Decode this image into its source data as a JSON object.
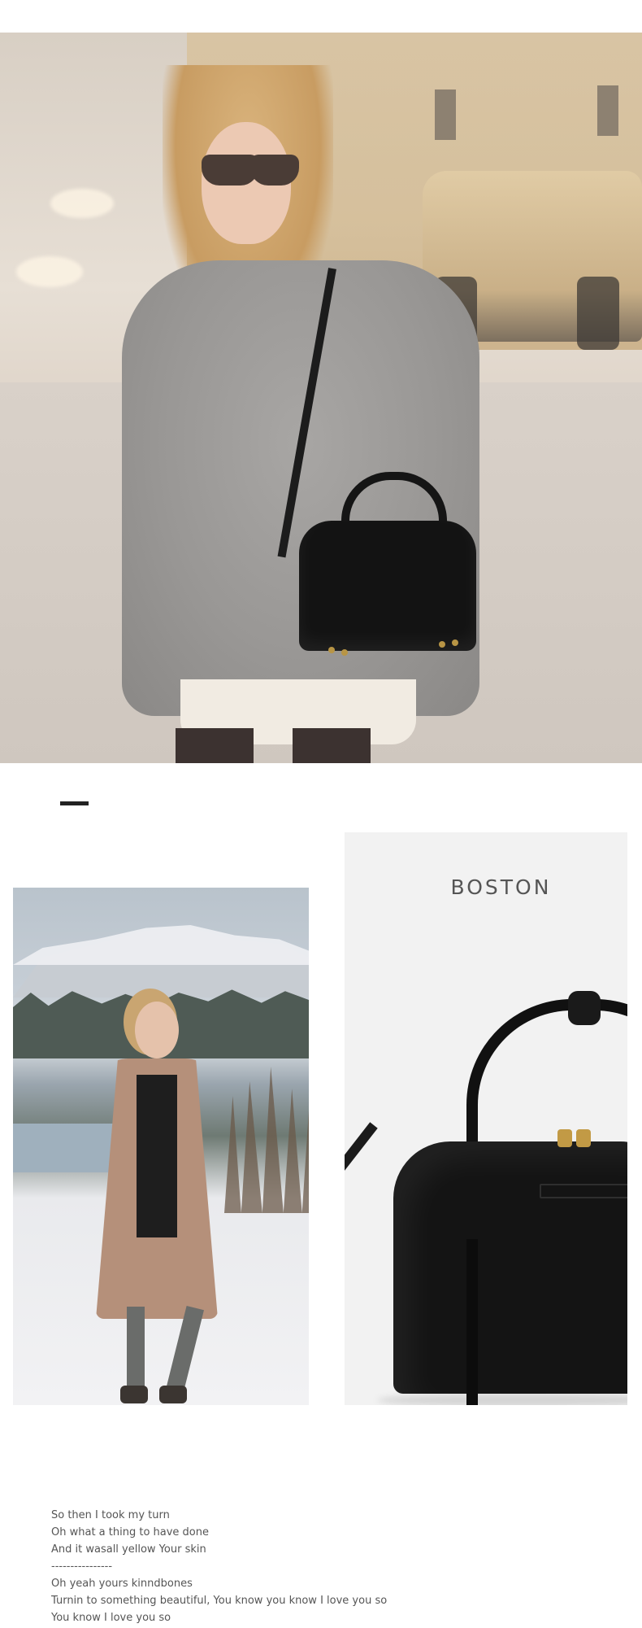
{
  "product": {
    "title": "BOSTON"
  },
  "lyrics": [
    "So then I took my turn",
    "Oh what a thing to have done",
    "And it wasall yellow Your skin",
    "----------------",
    "Oh yeah yours kinndbones",
    "Turnin to something beautiful, You know you know I love you so",
    "You know I love you so"
  ],
  "colors": {
    "background": "#ffffff",
    "panel": "#f2f2f2",
    "bag": "#141414",
    "text": "#555555"
  }
}
